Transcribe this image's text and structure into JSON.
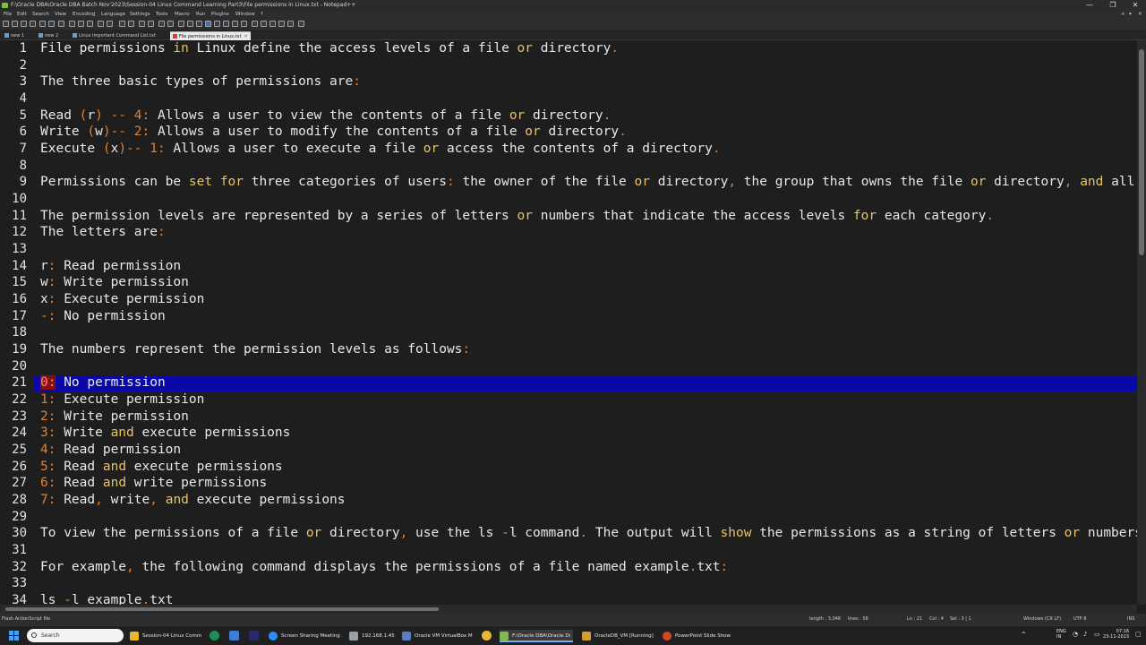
{
  "window": {
    "title": "F:\\Oracle DBA\\Oracle DBA Batch Nov'2023\\Session-04 Linux Command Learning Part3\\File permissions in Linux.txt - Notepad++",
    "controls": [
      "—",
      "❐",
      "✕"
    ]
  },
  "menu": [
    "File",
    "Edit",
    "Search",
    "View",
    "Encoding",
    "Language",
    "Settings",
    "Tools",
    "Macro",
    "Run",
    "Plugins",
    "Window",
    "?"
  ],
  "menu_right": [
    "+",
    "▾",
    "✕"
  ],
  "tabs": [
    {
      "label": "new 1",
      "active": false,
      "dirty": false
    },
    {
      "label": "new 2",
      "active": false,
      "dirty": false
    },
    {
      "label": "Linux Important Command List.txt",
      "active": false,
      "dirty": false
    },
    {
      "label": "File permissions in Linux.txt",
      "active": true,
      "dirty": true
    }
  ],
  "colors": {
    "keyword": "#e6c46a",
    "operator": "#e08030",
    "selection": "#0b08a8",
    "error_bg": "#8a1010"
  },
  "editor": {
    "lines": [
      {
        "n": "1",
        "segments": [
          {
            "t": "File permissions "
          },
          {
            "t": "in",
            "c": "kw"
          },
          {
            "t": " Linux define the access levels of a file "
          },
          {
            "t": "or",
            "c": "kw"
          },
          {
            "t": " directory"
          },
          {
            "t": ".",
            "c": "op"
          }
        ]
      },
      {
        "n": "2",
        "segments": []
      },
      {
        "n": "3",
        "segments": [
          {
            "t": "The three basic types of permissions are"
          },
          {
            "t": ":",
            "c": "op"
          }
        ]
      },
      {
        "n": "4",
        "segments": []
      },
      {
        "n": "5",
        "segments": [
          {
            "t": "Read "
          },
          {
            "t": "(",
            "c": "op"
          },
          {
            "t": "r"
          },
          {
            "t": ") -- 4:",
            "c": "op"
          },
          {
            "t": " Allows a user to view the contents of a file "
          },
          {
            "t": "or",
            "c": "kw"
          },
          {
            "t": " directory"
          },
          {
            "t": ".",
            "c": "op"
          }
        ]
      },
      {
        "n": "6",
        "segments": [
          {
            "t": "Write "
          },
          {
            "t": "(",
            "c": "op"
          },
          {
            "t": "w"
          },
          {
            "t": ")-- 2:",
            "c": "op"
          },
          {
            "t": " Allows a user to modify the contents of a file "
          },
          {
            "t": "or",
            "c": "kw"
          },
          {
            "t": " directory"
          },
          {
            "t": ".",
            "c": "op"
          }
        ]
      },
      {
        "n": "7",
        "segments": [
          {
            "t": "Execute "
          },
          {
            "t": "(",
            "c": "op"
          },
          {
            "t": "x"
          },
          {
            "t": ")-- 1:",
            "c": "op"
          },
          {
            "t": " Allows a user to execute a file "
          },
          {
            "t": "or",
            "c": "kw"
          },
          {
            "t": " access the contents of a directory"
          },
          {
            "t": ".",
            "c": "op"
          }
        ]
      },
      {
        "n": "8",
        "segments": []
      },
      {
        "n": "9",
        "segments": [
          {
            "t": "Permissions can be "
          },
          {
            "t": "set",
            "c": "kw"
          },
          {
            "t": " "
          },
          {
            "t": "for",
            "c": "kw"
          },
          {
            "t": " three categories of users"
          },
          {
            "t": ":",
            "c": "op"
          },
          {
            "t": " the owner of the file "
          },
          {
            "t": "or",
            "c": "kw"
          },
          {
            "t": " directory"
          },
          {
            "t": ",",
            "c": "op"
          },
          {
            "t": " the group that owns the file "
          },
          {
            "t": "or",
            "c": "kw"
          },
          {
            "t": " directory"
          },
          {
            "t": ",",
            "c": "op"
          },
          {
            "t": " "
          },
          {
            "t": "and",
            "c": "kw"
          },
          {
            "t": " all o"
          }
        ]
      },
      {
        "n": "10",
        "segments": []
      },
      {
        "n": "11",
        "segments": [
          {
            "t": "The permission levels are represented by a series of letters "
          },
          {
            "t": "or",
            "c": "kw"
          },
          {
            "t": " numbers that indicate the access levels "
          },
          {
            "t": "for",
            "c": "kw"
          },
          {
            "t": " each category"
          },
          {
            "t": ".",
            "c": "op"
          }
        ]
      },
      {
        "n": "12",
        "segments": [
          {
            "t": "The letters are"
          },
          {
            "t": ":",
            "c": "op"
          }
        ]
      },
      {
        "n": "13",
        "segments": []
      },
      {
        "n": "14",
        "segments": [
          {
            "t": "r"
          },
          {
            "t": ":",
            "c": "op"
          },
          {
            "t": " Read permission"
          }
        ]
      },
      {
        "n": "15",
        "segments": [
          {
            "t": "w"
          },
          {
            "t": ":",
            "c": "op"
          },
          {
            "t": " Write permission"
          }
        ]
      },
      {
        "n": "16",
        "segments": [
          {
            "t": "x"
          },
          {
            "t": ":",
            "c": "op"
          },
          {
            "t": " Execute permission"
          }
        ]
      },
      {
        "n": "17",
        "segments": [
          {
            "t": "-:",
            "c": "op"
          },
          {
            "t": " No permission"
          }
        ]
      },
      {
        "n": "18",
        "segments": []
      },
      {
        "n": "19",
        "segments": [
          {
            "t": "The numbers represent the permission levels as follows"
          },
          {
            "t": ":",
            "c": "op"
          }
        ]
      },
      {
        "n": "20",
        "segments": []
      },
      {
        "n": "21",
        "selected": true,
        "segments": [
          {
            "t": "0:",
            "c": "red"
          },
          {
            "t": " No permission"
          }
        ]
      },
      {
        "n": "22",
        "segments": [
          {
            "t": "1:",
            "c": "op"
          },
          {
            "t": " Execute permission"
          }
        ]
      },
      {
        "n": "23",
        "segments": [
          {
            "t": "2:",
            "c": "op"
          },
          {
            "t": " Write permission"
          }
        ]
      },
      {
        "n": "24",
        "segments": [
          {
            "t": "3:",
            "c": "op"
          },
          {
            "t": " Write "
          },
          {
            "t": "and",
            "c": "kw"
          },
          {
            "t": " execute permissions"
          }
        ]
      },
      {
        "n": "25",
        "segments": [
          {
            "t": "4:",
            "c": "op"
          },
          {
            "t": " Read permission"
          }
        ]
      },
      {
        "n": "26",
        "segments": [
          {
            "t": "5:",
            "c": "op"
          },
          {
            "t": " Read "
          },
          {
            "t": "and",
            "c": "kw"
          },
          {
            "t": " execute permissions"
          }
        ]
      },
      {
        "n": "27",
        "segments": [
          {
            "t": "6:",
            "c": "op"
          },
          {
            "t": " Read "
          },
          {
            "t": "and",
            "c": "kw"
          },
          {
            "t": " write permissions"
          }
        ]
      },
      {
        "n": "28",
        "segments": [
          {
            "t": "7:",
            "c": "op"
          },
          {
            "t": " Read"
          },
          {
            "t": ",",
            "c": "op"
          },
          {
            "t": " write"
          },
          {
            "t": ",",
            "c": "op"
          },
          {
            "t": " "
          },
          {
            "t": "and",
            "c": "kw"
          },
          {
            "t": " execute permissions"
          }
        ]
      },
      {
        "n": "29",
        "segments": []
      },
      {
        "n": "30",
        "segments": [
          {
            "t": "To view the permissions of a file "
          },
          {
            "t": "or",
            "c": "kw"
          },
          {
            "t": " directory"
          },
          {
            "t": ",",
            "c": "op"
          },
          {
            "t": " use the ls "
          },
          {
            "t": "-",
            "c": "op"
          },
          {
            "t": "l command"
          },
          {
            "t": ".",
            "c": "op"
          },
          {
            "t": " The output will "
          },
          {
            "t": "show",
            "c": "kw"
          },
          {
            "t": " the permissions as a string of letters "
          },
          {
            "t": "or",
            "c": "kw"
          },
          {
            "t": " numbers"
          },
          {
            "t": ",",
            "c": "op"
          }
        ]
      },
      {
        "n": "31",
        "segments": []
      },
      {
        "n": "32",
        "segments": [
          {
            "t": "For example"
          },
          {
            "t": ",",
            "c": "op"
          },
          {
            "t": " the following command displays the permissions of a file named example"
          },
          {
            "t": ".",
            "c": "op"
          },
          {
            "t": "txt"
          },
          {
            "t": ":",
            "c": "op"
          }
        ]
      },
      {
        "n": "33",
        "segments": []
      },
      {
        "n": "34",
        "segments": [
          {
            "t": "ls "
          },
          {
            "t": "-",
            "c": "op"
          },
          {
            "t": "l example"
          },
          {
            "t": ".",
            "c": "op"
          },
          {
            "t": "txt"
          }
        ]
      }
    ]
  },
  "status": {
    "left": "Flash ActionScript file",
    "length": "length : 3,046",
    "lines": "lines : 58",
    "ln": "Ln : 21",
    "col": "Col : 4",
    "sel": "Sel : 3 | 1",
    "eol": "Windows (CR LF)",
    "enc": "UTF-8",
    "mode": "INS"
  },
  "taskbar": {
    "search_placeholder": "Search",
    "items": [
      {
        "label": "Session-04 Linux Comm",
        "icon": "folder-icon",
        "color": "#e8b830"
      },
      {
        "label": "Screen Sharing Meeting",
        "icon": "zoom-icon",
        "color": "#2d8cff"
      },
      {
        "label": "192.168.1.45",
        "icon": "putty-icon",
        "color": "#9aa0a6"
      },
      {
        "label": "Oracle VM VirtualBox M",
        "icon": "virtualbox-icon",
        "color": "#5a7fc0"
      },
      {
        "label": "F:\\Oracle DBA\\Oracle Di",
        "icon": "notepadpp-icon",
        "color": "#7fba4c",
        "active": true
      },
      {
        "label": "OracleDB_VM [Running]",
        "icon": "vm-icon",
        "color": "#d0a030"
      },
      {
        "label": "PowerPoint Slide Show",
        "icon": "powerpoint-icon",
        "color": "#d24726"
      }
    ],
    "tray": {
      "lang1": "ENG",
      "lang2": "IN",
      "time": "07:16",
      "date": "23-11-2023"
    }
  }
}
